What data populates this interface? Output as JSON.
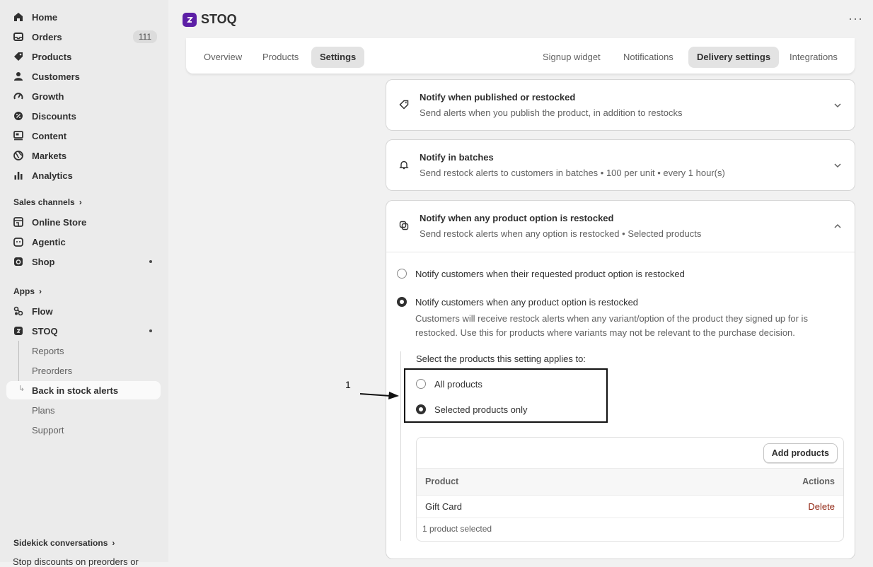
{
  "sidebar": {
    "nav": [
      {
        "label": "Home",
        "icon": "home-icon"
      },
      {
        "label": "Orders",
        "icon": "orders-icon",
        "count": "111"
      },
      {
        "label": "Products",
        "icon": "tag-icon"
      },
      {
        "label": "Customers",
        "icon": "person-icon"
      },
      {
        "label": "Growth",
        "icon": "gauge-icon"
      },
      {
        "label": "Discounts",
        "icon": "discount-icon"
      },
      {
        "label": "Content",
        "icon": "content-icon"
      },
      {
        "label": "Markets",
        "icon": "globe-icon"
      },
      {
        "label": "Analytics",
        "icon": "bar-chart-icon"
      }
    ],
    "sales_channels_label": "Sales channels",
    "channels": [
      {
        "label": "Online Store",
        "icon": "store-icon"
      },
      {
        "label": "Agentic",
        "icon": "agentic-icon"
      },
      {
        "label": "Shop",
        "icon": "shop-icon"
      }
    ],
    "apps_label": "Apps",
    "apps": [
      {
        "label": "Flow",
        "icon": "flow-icon"
      },
      {
        "label": "STOQ",
        "icon": "stoq-icon"
      }
    ],
    "stoq_sub": [
      "Reports",
      "Preorders",
      "Back in stock alerts",
      "Plans",
      "Support"
    ],
    "sidekick_label": "Sidekick conversations",
    "sidekick_preview": "Stop discounts on preorders or"
  },
  "header": {
    "app_title": "STOQ",
    "more": "···"
  },
  "tabs": {
    "left": [
      "Overview",
      "Products",
      "Settings"
    ],
    "right": [
      "Signup widget",
      "Notifications",
      "Delivery settings",
      "Integrations"
    ],
    "active_left": "Settings",
    "active_right": "Delivery settings"
  },
  "cards": {
    "published": {
      "title": "Notify when published or restocked",
      "desc": "Send alerts when you publish the product, in addition to restocks"
    },
    "batches": {
      "title": "Notify in batches",
      "desc": "Send restock alerts to customers in batches • 100 per unit • every 1 hour(s)"
    },
    "option": {
      "title": "Notify when any product option is restocked",
      "desc": "Send restock alerts when any option is restocked • Selected products",
      "radio1": "Notify customers when their requested product option is restocked",
      "radio2": "Notify customers when any product option is restocked",
      "help1": "Customers will receive restock alerts when any variant/option of the product they signed up for is",
      "help2": "restocked. Use this for products where variants may not be relevant to the purchase decision.",
      "select_label": "Select the products this setting applies to:",
      "all_products": "All products",
      "selected_only": "Selected products only",
      "add_products": "Add products",
      "col_product": "Product",
      "col_actions": "Actions",
      "rows": [
        {
          "product": "Gift Card",
          "action": "Delete"
        }
      ],
      "footer": "1 product selected"
    }
  },
  "annotation": {
    "label": "1"
  },
  "colors": {
    "accent": "#5c1fa6",
    "danger": "#8e1f0b"
  }
}
